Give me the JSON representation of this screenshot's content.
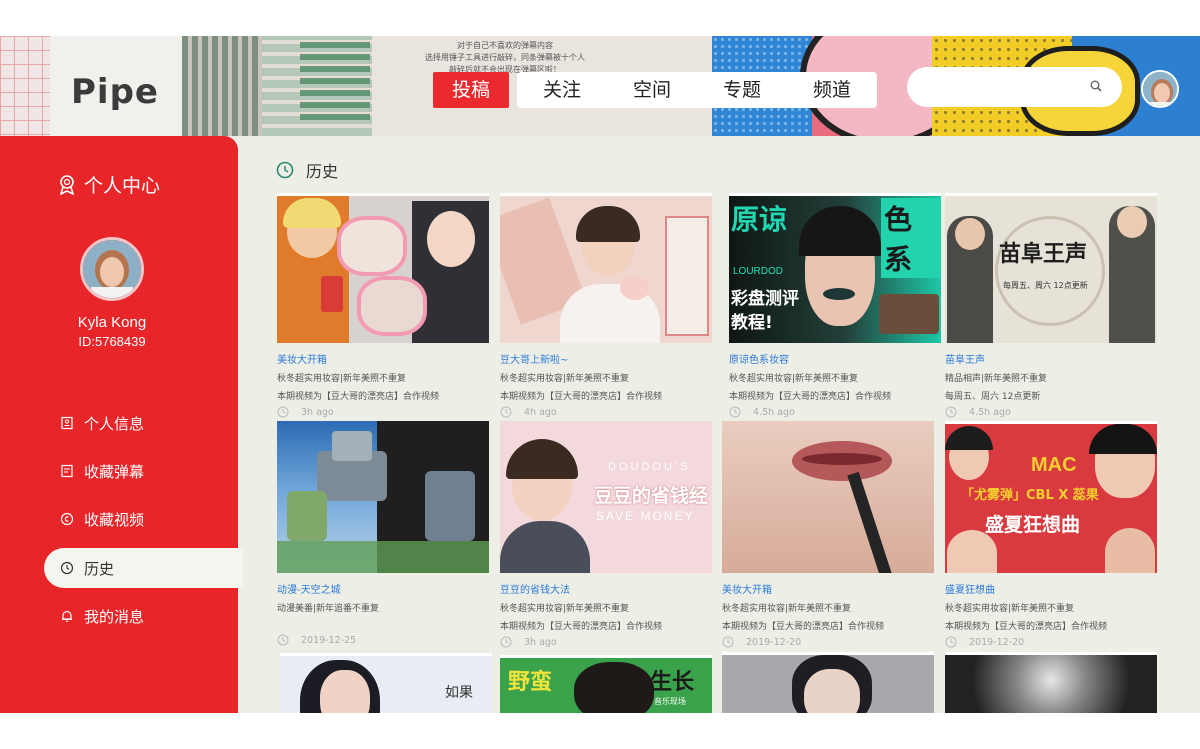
{
  "banner": {
    "notice_lines": [
      "对于自己不喜欢的弹幕内容",
      "选择用锤子工具进行敲碎，同条弹幕被十个人",
      "敲碎后就不会出现在弹幕区啦！"
    ]
  },
  "logo": {
    "text": "Pipe"
  },
  "nav": {
    "tabs": [
      {
        "label": "投稿",
        "active": true
      },
      {
        "label": "关注",
        "active": false
      },
      {
        "label": "空间",
        "active": false
      },
      {
        "label": "专题",
        "active": false
      },
      {
        "label": "频道",
        "active": false
      }
    ]
  },
  "search": {
    "value": "",
    "placeholder": "",
    "icon": "search-icon"
  },
  "sidebar": {
    "header": "个人中心",
    "user": {
      "name": "Kyla Kong",
      "id": "ID:5768439"
    },
    "menu": [
      {
        "label": "个人信息",
        "icon": "id-card-icon",
        "active": false
      },
      {
        "label": "收藏弹幕",
        "icon": "bullet-comment-icon",
        "active": false
      },
      {
        "label": "收藏视频",
        "icon": "video-collect-icon",
        "active": false
      },
      {
        "label": "历史",
        "icon": "clock-icon",
        "active": true
      },
      {
        "label": "我的消息",
        "icon": "bell-icon",
        "active": false
      }
    ]
  },
  "section": {
    "title": "历史",
    "icon": "clock-icon"
  },
  "cards": [
    {
      "title": "美妆大开箱",
      "line1": "秋冬超实用妆容|新年美照不重复",
      "line2": "本期视频为【豆大哥的漂亮店】合作视频",
      "time": "3h ago"
    },
    {
      "title": "豆大哥上新啦~",
      "line1": "秋冬超实用妆容|新年美照不重复",
      "line2": "本期视频为【豆大哥的漂亮店】合作视频",
      "time": "4h ago"
    },
    {
      "title": "原谅色系妆容",
      "line1": "秋冬超实用妆容|新年美照不重复",
      "line2": "本期视频为【豆大哥的漂亮店】合作视频",
      "time": "4.5h ago"
    },
    {
      "title": "苗阜王声",
      "line1": "精品相声|新年美照不重复",
      "line2": "每周五、周六 12点更新",
      "time": "4.5h ago"
    },
    {
      "title": "动漫-天空之城",
      "line1": "动漫美番|新年追番不重复",
      "line2": "",
      "time": "2019-12-25"
    },
    {
      "title": "豆豆的省钱大法",
      "line1": "秋冬超实用妆容|新年美照不重复",
      "line2": "本期视频为【豆大哥的漂亮店】合作视频",
      "time": "3h ago"
    },
    {
      "title": "美妆大开箱",
      "line1": "秋冬超实用妆容|新年美照不重复",
      "line2": "本期视频为【豆大哥的漂亮店】合作视频",
      "time": "2019-12-20"
    },
    {
      "title": "盛夏狂想曲",
      "line1": "秋冬超实用妆容|新年美照不重复",
      "line2": "本期视频为【豆大哥的漂亮店】合作视频",
      "time": "2019-12-20"
    }
  ],
  "thumb_text": {
    "t3_a": "原谅",
    "t3_b": "色系",
    "t3_c": "LOURDOD",
    "t3_d": "彩盘测评",
    "t3_e": "教程!",
    "t4_a": "苗阜王声",
    "t4_b": "每周五、周六  12点更新",
    "t6_a": "DOUDOU'S",
    "t6_b": "豆豆的省钱经",
    "t6_c": "SAVE MONEY",
    "t8_a": "MAC",
    "t8_b": "「尤雾弹」CBL X 蕊果",
    "t8_c": "盛夏狂想曲",
    "t9_a": "如果",
    "t10_a": "野蛮",
    "t10_b": "生长",
    "t10_c": "音乐现场"
  },
  "colors": {
    "brand_red": "#e8262a",
    "link_blue": "#2b7bd8",
    "content_bg": "#edeee6"
  }
}
